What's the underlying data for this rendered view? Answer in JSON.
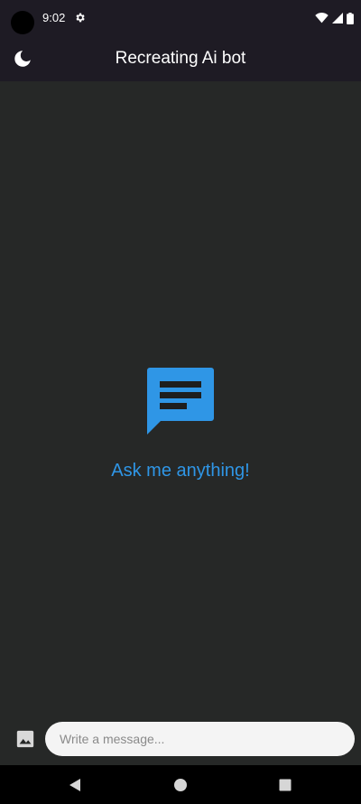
{
  "status_bar": {
    "time": "9:02",
    "icons": [
      "gear-icon",
      "wifi-icon",
      "signal-icon",
      "battery-icon"
    ]
  },
  "app_bar": {
    "title": "Recreating Ai bot",
    "theme_toggle_icon": "moon-icon"
  },
  "empty_state": {
    "icon": "chat-bubble-icon",
    "text": "Ask me anything!"
  },
  "composer": {
    "image_button_icon": "image-icon",
    "placeholder": "Write a message...",
    "value": ""
  },
  "nav_bar": {
    "buttons": [
      "back-icon",
      "home-icon",
      "recents-icon"
    ]
  },
  "colors": {
    "app_bar_bg": "#1e1b24",
    "background": "#262827",
    "accent": "#2f96e6",
    "input_bg": "#f4f4f4"
  }
}
